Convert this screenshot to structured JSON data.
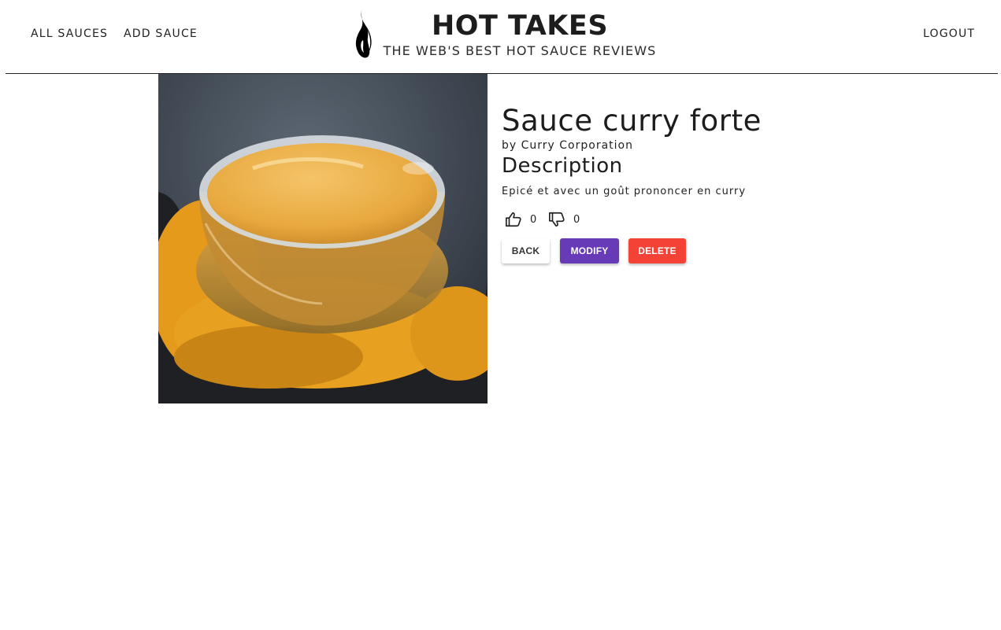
{
  "nav": {
    "all_sauces": "ALL SAUCES",
    "add_sauce": "ADD SAUCE",
    "logout": "LOGOUT"
  },
  "header": {
    "title": "HOT TAKES",
    "subtitle": "THE WEB'S BEST HOT SAUCE REVIEWS",
    "logo_icon": "flame-icon"
  },
  "sauce": {
    "name": "Sauce curry forte",
    "maker": "by Curry Corporation",
    "description_heading": "Description",
    "description": "Epicé et avec un goût prononcer en curry",
    "likes": "0",
    "dislikes": "0"
  },
  "buttons": {
    "back": "BACK",
    "modify": "MODIFY",
    "delete": "DELETE"
  },
  "colors": {
    "modify": "#673ab7",
    "delete": "#f44336",
    "curry": "#e8a33a"
  }
}
